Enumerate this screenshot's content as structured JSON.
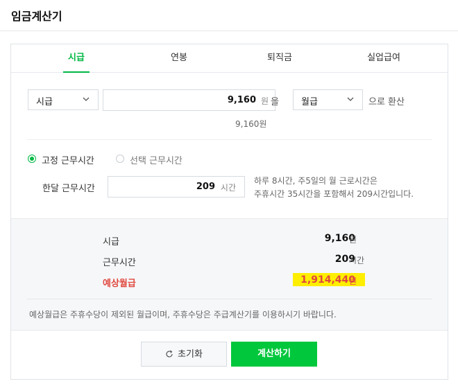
{
  "page": {
    "title": "임금계산기"
  },
  "tabs": [
    {
      "label": "시급",
      "active": true
    },
    {
      "label": "연봉",
      "active": false
    },
    {
      "label": "퇴직금",
      "active": false
    },
    {
      "label": "실업급여",
      "active": false
    }
  ],
  "converter": {
    "from_unit": "시급",
    "amount": "9,160",
    "amount_unit": "원",
    "particle": "을",
    "to_unit": "월급",
    "suffix": "으로 환산",
    "echo": "9,160원"
  },
  "work_time": {
    "fixed_label": "고정 근무시간",
    "selected_label": "선택 근무시간",
    "mode": "fixed",
    "monthly_label": "한달 근무시간",
    "monthly_value": "209",
    "monthly_unit": "시간",
    "hint_line1": "하루 8시간, 주5일의 월 근로시간은",
    "hint_line2": "주휴시간 35시간을 포함해서 209시간입니다."
  },
  "result": {
    "hourly_label": "시급",
    "hourly_value": "9,160",
    "hourly_unit": "원",
    "hours_label": "근무시간",
    "hours_value": "209",
    "hours_unit": "시간",
    "monthly_label": "예상월급",
    "monthly_value": "1,914,440",
    "monthly_unit": "원",
    "note": "예상월급은 주휴수당이 제외된 월급이며, 주휴수당은 주급계산기를 이용하시기 바랍니다."
  },
  "buttons": {
    "reset_label": "초기화",
    "calc_label": "계산하기"
  },
  "colors": {
    "accent": "#00b843",
    "button_green": "#00c73c",
    "highlight": "#ffee00",
    "warning_red": "#e0483e"
  },
  "icons": {
    "select_arrow": "chevron-down-icon",
    "reset": "refresh-icon"
  }
}
